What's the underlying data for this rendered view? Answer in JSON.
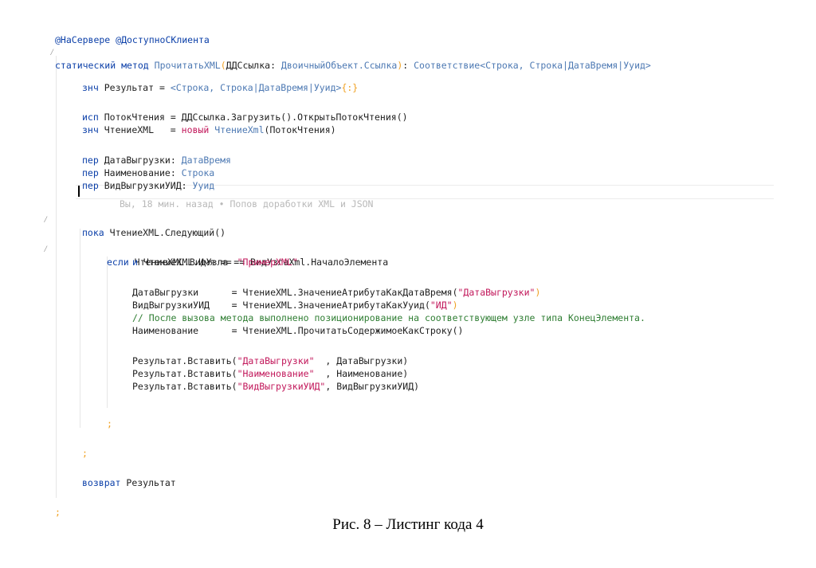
{
  "code": {
    "l1_annotation": "@НаСервере @ДоступноСКлиента",
    "l2_kw": "статический метод",
    "l2_name": "ПрочитатьXML",
    "l2_param": "ДДСсылка",
    "l2_param_type": "ДвоичныйОбъект.Ссылка",
    "l2_ret_type_pre": "Соответствие<Строка, Строка|ДатаВремя|Ууид>",
    "l3_kw": "знч",
    "l3_var": "Результат",
    "l3_type": "<Строка, Строка|ДатаВремя|Ууид>",
    "l3_lit": "{:}",
    "l4_kw": "исп",
    "l4_var": "ПотокЧтения",
    "l4_expr": "ДДСсылка.Загрузить().ОткрытьПотокЧтения()",
    "l5_kw": "знч",
    "l5_var": "ЧтениеXML",
    "l5_new": "новый",
    "l5_type": "ЧтениеXml",
    "l5_arg": "(ПотокЧтения)",
    "l6_kw": "пер",
    "l6_var": "ДатаВыгрузки",
    "l6_type": "ДатаВремя",
    "l7_kw": "пер",
    "l7_var": "Наименование",
    "l7_type": "Строка",
    "l8_kw": "пер",
    "l8_var": "ВидВыгрузкиУИД",
    "l8_type": "Ууид",
    "blame": "Вы, 18 мин. назад • Попов доработки XML и JSON",
    "l9_kw": "пока",
    "l9_expr": "ЧтениеXML.Следующий()",
    "l10_kw": "если",
    "l10_expr": "ЧтениеXML.ВидУзла == ВидУзлаXml.НачалоЭлемента",
    "l11_kw": "и",
    "l11_expr": "ЧтениеXML.Имя ==",
    "l11_str": "\"ПримерXML\"",
    "l12_var": "ДатаВыгрузки      = ЧтениеXML.ЗначениеАтрибутаКакДатаВремя(",
    "l12_str": "\"ДатаВыгрузки\"",
    "l13_var": "ВидВыгрузкиУИД    = ЧтениеXML.ЗначениеАтрибутаКакУуид(",
    "l13_str": "\"ИД\"",
    "l14_comment": "// После вызова метода выполнено позиционирование на соответствующем узле типа КонецЭлемента.",
    "l15_var": "Наименование      = ЧтениеXML.ПрочитатьСодержимоеКакСтроку()",
    "l16_call": "Результат.Вставить(",
    "l16_str": "\"ДатаВыгрузки\"",
    "l16_rest": "  , ДатаВыгрузки)",
    "l17_call": "Результат.Вставить(",
    "l17_str": "\"Наименование\"",
    "l17_rest": "  , Наименование)",
    "l18_call": "Результат.Вставить(",
    "l18_str": "\"ВидВыгрузкиУИД\"",
    "l18_rest": ", ВидВыгрузкиУИД)",
    "semi": ";",
    "ret_kw": "возврат",
    "ret_var": "Результат"
  },
  "caption": "Рис. 8 – Листинг кода 4"
}
